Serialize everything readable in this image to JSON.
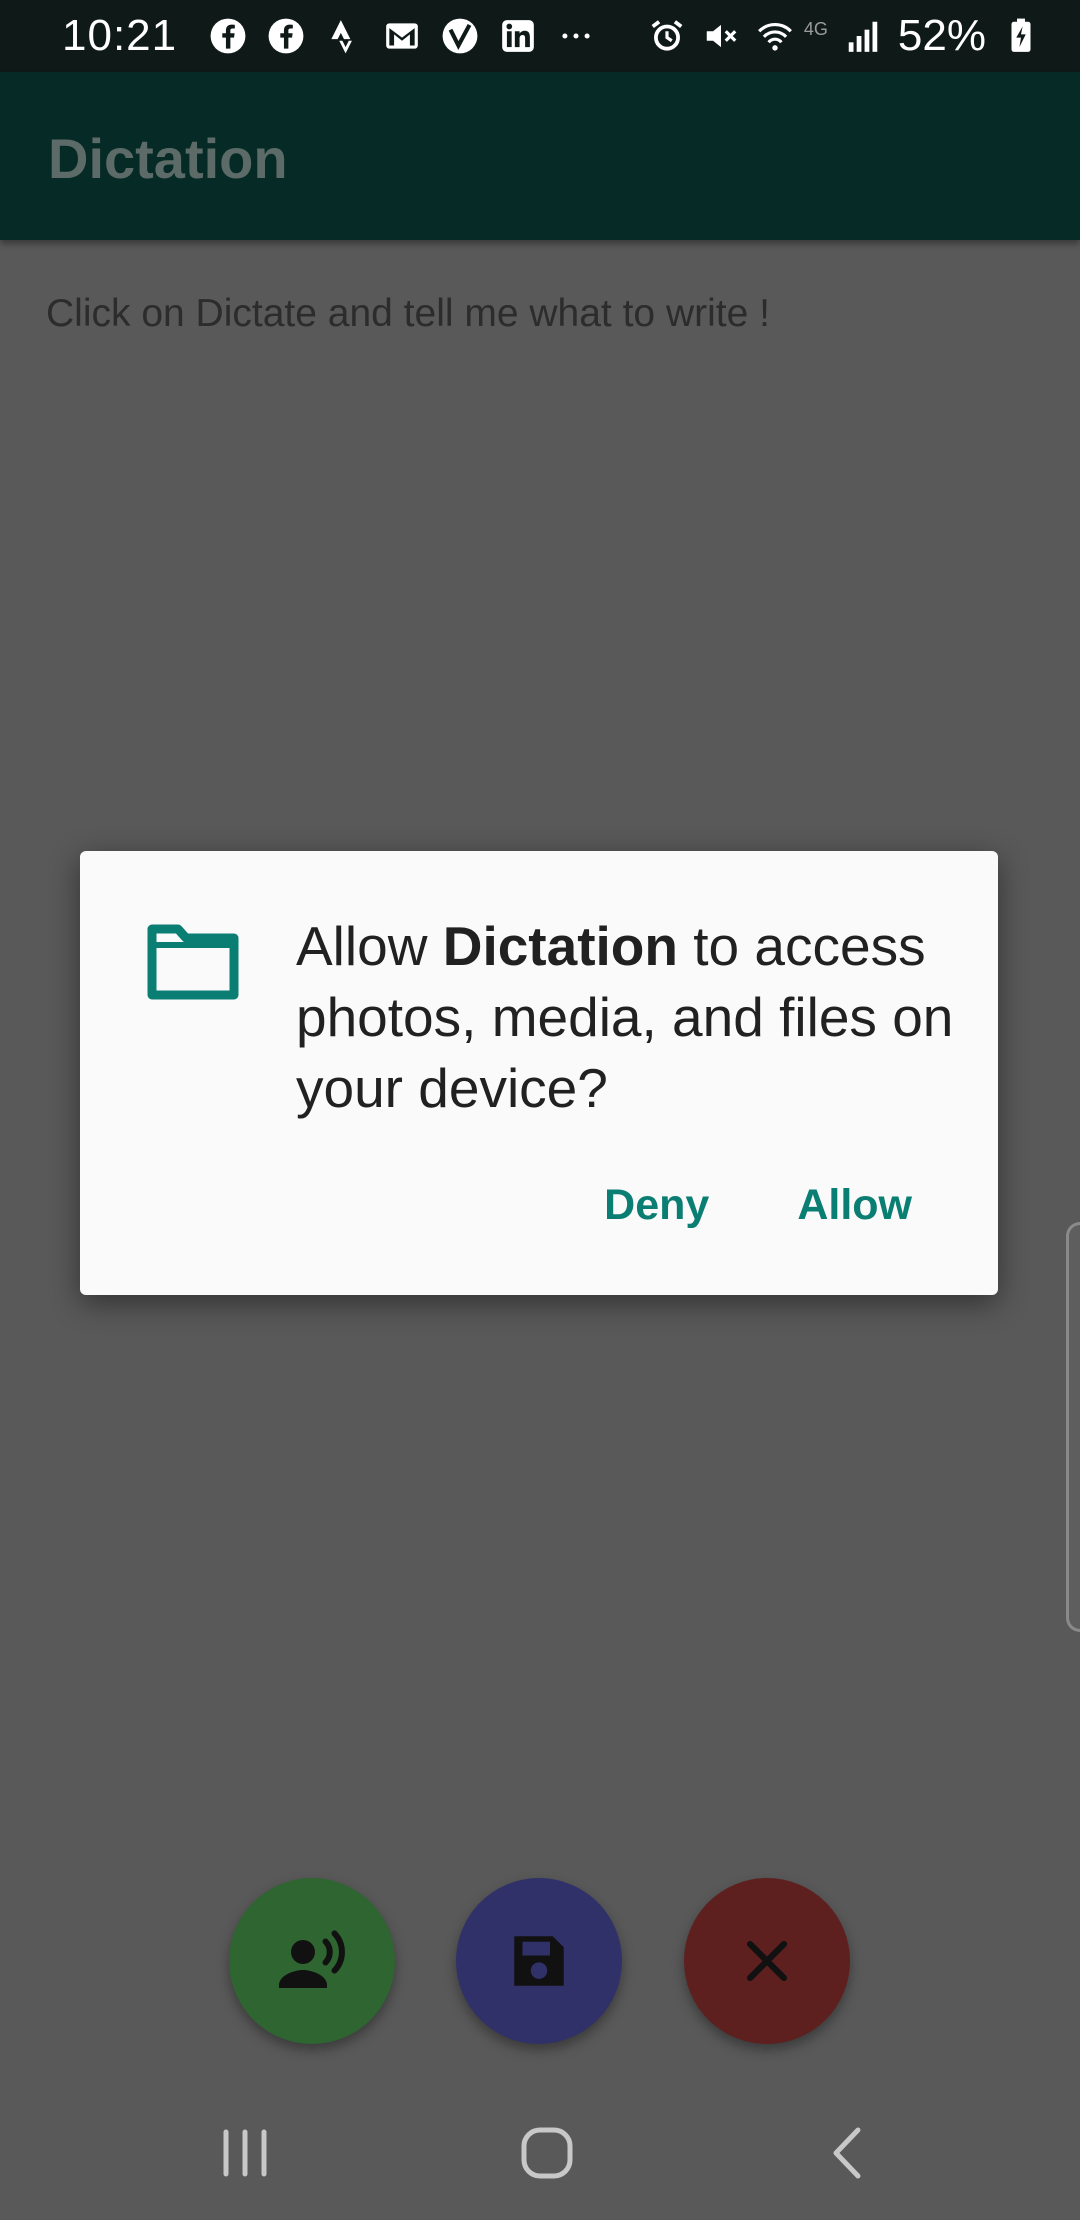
{
  "status_bar": {
    "time": "10:21",
    "battery": "52%",
    "network": "4G"
  },
  "app_bar": {
    "title": "Dictation"
  },
  "content": {
    "hint": "Click on Dictate and tell me what to write !"
  },
  "dialog": {
    "prefix": "Allow ",
    "app_name": "Dictation",
    "suffix": " to access photos, media, and files on your device?",
    "deny_label": "Deny",
    "allow_label": "Allow",
    "icon": "folder-icon"
  },
  "fabs": [
    {
      "icon": "record-voice-icon",
      "color": "#2e6531"
    },
    {
      "icon": "save-icon",
      "color": "#2f3168"
    },
    {
      "icon": "close-icon",
      "color": "#5e1f1f"
    }
  ],
  "colors": {
    "primary_dark": "#062a25",
    "accent": "#0b7e74",
    "scrim_background": "#595959"
  }
}
